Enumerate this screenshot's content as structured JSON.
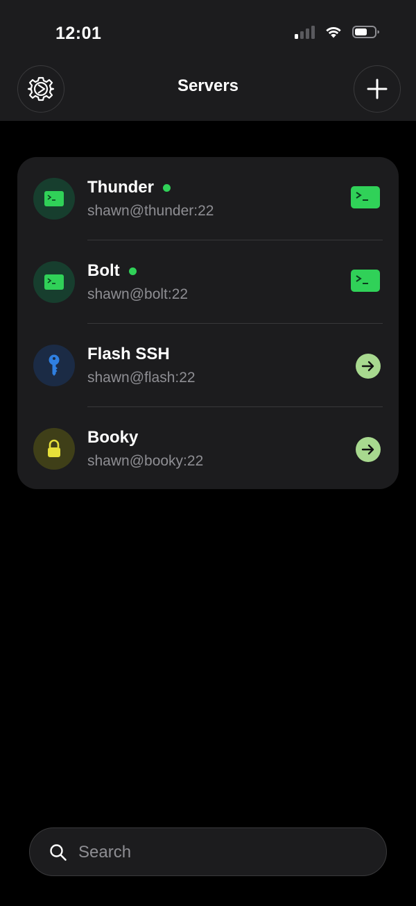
{
  "status_bar": {
    "time": "12:01"
  },
  "nav": {
    "title": "Servers",
    "settings_icon": "gear-icon",
    "add_icon": "plus-icon"
  },
  "servers": [
    {
      "name": "Thunder",
      "address": "shawn@thunder:22",
      "online": true,
      "icon": "terminal-icon",
      "action": "terminal"
    },
    {
      "name": "Bolt",
      "address": "shawn@bolt:22",
      "online": true,
      "icon": "terminal-icon",
      "action": "terminal"
    },
    {
      "name": "Flash SSH",
      "address": "shawn@flash:22",
      "online": false,
      "icon": "key-icon",
      "action": "connect"
    },
    {
      "name": "Booky",
      "address": "shawn@booky:22",
      "online": false,
      "icon": "lock-icon",
      "action": "connect"
    }
  ],
  "search": {
    "placeholder": "Search",
    "value": ""
  },
  "colors": {
    "online": "#30d158",
    "terminal_icon_bg": "#173e2e",
    "key_icon_bg": "#1b2b45",
    "lock_icon_bg": "#3f3f18",
    "connect_button": "#a8d98f"
  }
}
